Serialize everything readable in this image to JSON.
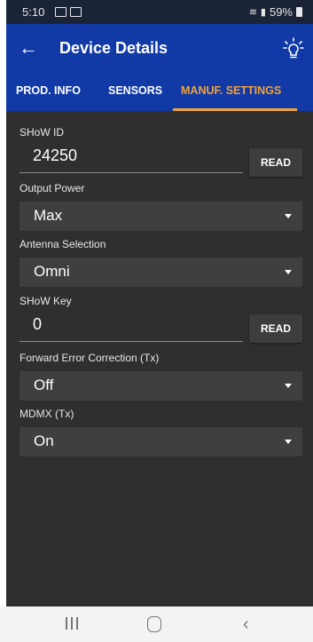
{
  "status_bar": {
    "time": "5:10",
    "battery": "59%"
  },
  "app_bar": {
    "title": "Device Details",
    "back_icon": "arrow-left-icon",
    "light_icon": "lightbulb-icon"
  },
  "tabs": [
    {
      "label": "PROD. INFO",
      "active": false
    },
    {
      "label": "SENSORS",
      "active": false
    },
    {
      "label": "MANUF. SETTINGS",
      "active": true
    }
  ],
  "form": {
    "show_id": {
      "label": "SHoW ID",
      "value": "24250",
      "button": "READ"
    },
    "output_power": {
      "label": "Output Power",
      "value": "Max"
    },
    "antenna_selection": {
      "label": "Antenna Selection",
      "value": "Omni"
    },
    "show_key": {
      "label": "SHoW Key",
      "value": "0",
      "button": "READ"
    },
    "fec": {
      "label": "Forward Error Correction (Tx)",
      "value": "Off"
    },
    "mdmx": {
      "label": "MDMX (Tx)",
      "value": "On"
    }
  },
  "colors": {
    "app_bar": "#113aa7",
    "accent": "#f0a23c",
    "background": "#2f2f2f"
  }
}
